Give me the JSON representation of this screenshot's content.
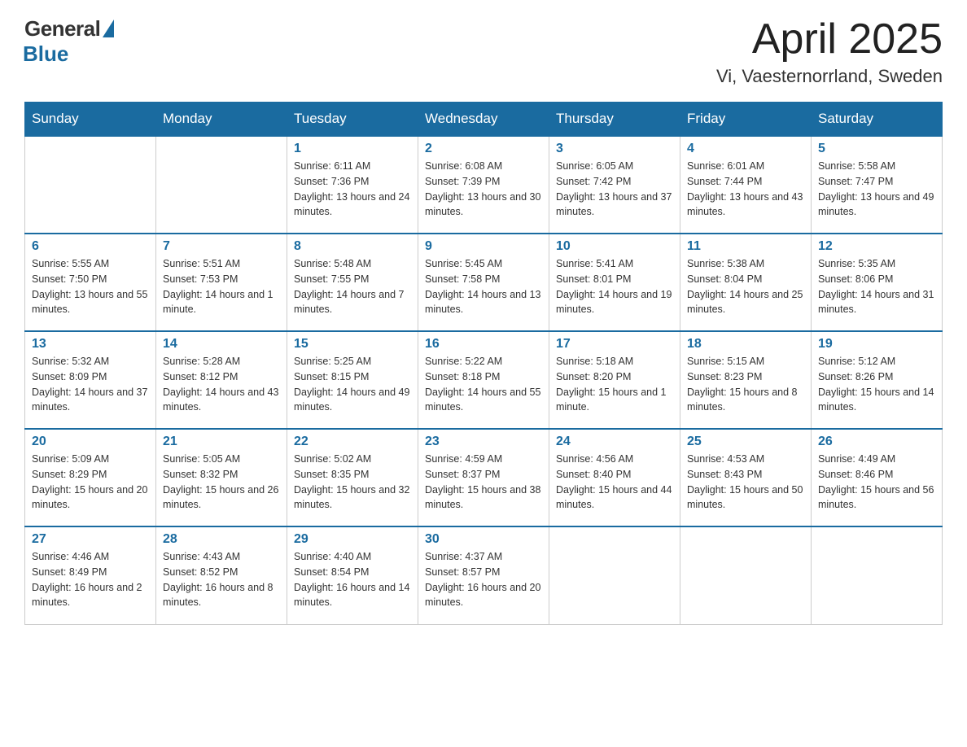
{
  "header": {
    "logo_general": "General",
    "logo_blue": "Blue",
    "month_title": "April 2025",
    "location": "Vi, Vaesternorrland, Sweden"
  },
  "weekdays": [
    "Sunday",
    "Monday",
    "Tuesday",
    "Wednesday",
    "Thursday",
    "Friday",
    "Saturday"
  ],
  "weeks": [
    [
      {
        "day": "",
        "sunrise": "",
        "sunset": "",
        "daylight": ""
      },
      {
        "day": "",
        "sunrise": "",
        "sunset": "",
        "daylight": ""
      },
      {
        "day": "1",
        "sunrise": "Sunrise: 6:11 AM",
        "sunset": "Sunset: 7:36 PM",
        "daylight": "Daylight: 13 hours and 24 minutes."
      },
      {
        "day": "2",
        "sunrise": "Sunrise: 6:08 AM",
        "sunset": "Sunset: 7:39 PM",
        "daylight": "Daylight: 13 hours and 30 minutes."
      },
      {
        "day": "3",
        "sunrise": "Sunrise: 6:05 AM",
        "sunset": "Sunset: 7:42 PM",
        "daylight": "Daylight: 13 hours and 37 minutes."
      },
      {
        "day": "4",
        "sunrise": "Sunrise: 6:01 AM",
        "sunset": "Sunset: 7:44 PM",
        "daylight": "Daylight: 13 hours and 43 minutes."
      },
      {
        "day": "5",
        "sunrise": "Sunrise: 5:58 AM",
        "sunset": "Sunset: 7:47 PM",
        "daylight": "Daylight: 13 hours and 49 minutes."
      }
    ],
    [
      {
        "day": "6",
        "sunrise": "Sunrise: 5:55 AM",
        "sunset": "Sunset: 7:50 PM",
        "daylight": "Daylight: 13 hours and 55 minutes."
      },
      {
        "day": "7",
        "sunrise": "Sunrise: 5:51 AM",
        "sunset": "Sunset: 7:53 PM",
        "daylight": "Daylight: 14 hours and 1 minute."
      },
      {
        "day": "8",
        "sunrise": "Sunrise: 5:48 AM",
        "sunset": "Sunset: 7:55 PM",
        "daylight": "Daylight: 14 hours and 7 minutes."
      },
      {
        "day": "9",
        "sunrise": "Sunrise: 5:45 AM",
        "sunset": "Sunset: 7:58 PM",
        "daylight": "Daylight: 14 hours and 13 minutes."
      },
      {
        "day": "10",
        "sunrise": "Sunrise: 5:41 AM",
        "sunset": "Sunset: 8:01 PM",
        "daylight": "Daylight: 14 hours and 19 minutes."
      },
      {
        "day": "11",
        "sunrise": "Sunrise: 5:38 AM",
        "sunset": "Sunset: 8:04 PM",
        "daylight": "Daylight: 14 hours and 25 minutes."
      },
      {
        "day": "12",
        "sunrise": "Sunrise: 5:35 AM",
        "sunset": "Sunset: 8:06 PM",
        "daylight": "Daylight: 14 hours and 31 minutes."
      }
    ],
    [
      {
        "day": "13",
        "sunrise": "Sunrise: 5:32 AM",
        "sunset": "Sunset: 8:09 PM",
        "daylight": "Daylight: 14 hours and 37 minutes."
      },
      {
        "day": "14",
        "sunrise": "Sunrise: 5:28 AM",
        "sunset": "Sunset: 8:12 PM",
        "daylight": "Daylight: 14 hours and 43 minutes."
      },
      {
        "day": "15",
        "sunrise": "Sunrise: 5:25 AM",
        "sunset": "Sunset: 8:15 PM",
        "daylight": "Daylight: 14 hours and 49 minutes."
      },
      {
        "day": "16",
        "sunrise": "Sunrise: 5:22 AM",
        "sunset": "Sunset: 8:18 PM",
        "daylight": "Daylight: 14 hours and 55 minutes."
      },
      {
        "day": "17",
        "sunrise": "Sunrise: 5:18 AM",
        "sunset": "Sunset: 8:20 PM",
        "daylight": "Daylight: 15 hours and 1 minute."
      },
      {
        "day": "18",
        "sunrise": "Sunrise: 5:15 AM",
        "sunset": "Sunset: 8:23 PM",
        "daylight": "Daylight: 15 hours and 8 minutes."
      },
      {
        "day": "19",
        "sunrise": "Sunrise: 5:12 AM",
        "sunset": "Sunset: 8:26 PM",
        "daylight": "Daylight: 15 hours and 14 minutes."
      }
    ],
    [
      {
        "day": "20",
        "sunrise": "Sunrise: 5:09 AM",
        "sunset": "Sunset: 8:29 PM",
        "daylight": "Daylight: 15 hours and 20 minutes."
      },
      {
        "day": "21",
        "sunrise": "Sunrise: 5:05 AM",
        "sunset": "Sunset: 8:32 PM",
        "daylight": "Daylight: 15 hours and 26 minutes."
      },
      {
        "day": "22",
        "sunrise": "Sunrise: 5:02 AM",
        "sunset": "Sunset: 8:35 PM",
        "daylight": "Daylight: 15 hours and 32 minutes."
      },
      {
        "day": "23",
        "sunrise": "Sunrise: 4:59 AM",
        "sunset": "Sunset: 8:37 PM",
        "daylight": "Daylight: 15 hours and 38 minutes."
      },
      {
        "day": "24",
        "sunrise": "Sunrise: 4:56 AM",
        "sunset": "Sunset: 8:40 PM",
        "daylight": "Daylight: 15 hours and 44 minutes."
      },
      {
        "day": "25",
        "sunrise": "Sunrise: 4:53 AM",
        "sunset": "Sunset: 8:43 PM",
        "daylight": "Daylight: 15 hours and 50 minutes."
      },
      {
        "day": "26",
        "sunrise": "Sunrise: 4:49 AM",
        "sunset": "Sunset: 8:46 PM",
        "daylight": "Daylight: 15 hours and 56 minutes."
      }
    ],
    [
      {
        "day": "27",
        "sunrise": "Sunrise: 4:46 AM",
        "sunset": "Sunset: 8:49 PM",
        "daylight": "Daylight: 16 hours and 2 minutes."
      },
      {
        "day": "28",
        "sunrise": "Sunrise: 4:43 AM",
        "sunset": "Sunset: 8:52 PM",
        "daylight": "Daylight: 16 hours and 8 minutes."
      },
      {
        "day": "29",
        "sunrise": "Sunrise: 4:40 AM",
        "sunset": "Sunset: 8:54 PM",
        "daylight": "Daylight: 16 hours and 14 minutes."
      },
      {
        "day": "30",
        "sunrise": "Sunrise: 4:37 AM",
        "sunset": "Sunset: 8:57 PM",
        "daylight": "Daylight: 16 hours and 20 minutes."
      },
      {
        "day": "",
        "sunrise": "",
        "sunset": "",
        "daylight": ""
      },
      {
        "day": "",
        "sunrise": "",
        "sunset": "",
        "daylight": ""
      },
      {
        "day": "",
        "sunrise": "",
        "sunset": "",
        "daylight": ""
      }
    ]
  ]
}
